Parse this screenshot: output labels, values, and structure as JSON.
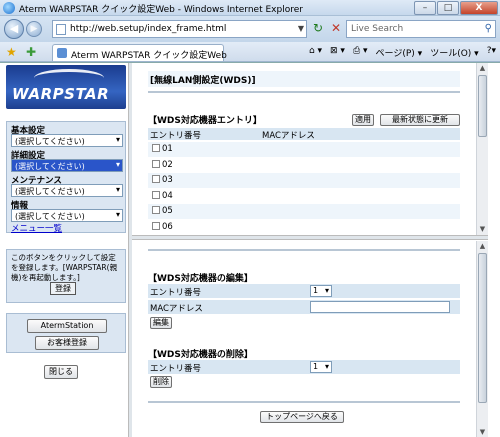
{
  "window": {
    "title": "Aterm WARPSTAR クイック設定Web - Windows Internet Explorer",
    "minimize_label": "–",
    "maximize_label": "□",
    "close_label": "X"
  },
  "address_bar": {
    "url": "http://web.setup/index_frame.html",
    "search_placeholder": "Live Search"
  },
  "tab": {
    "label": "Aterm WARPSTAR クイック設定Web"
  },
  "toolbar": {
    "home": "⌂ ▾",
    "feeds": "⊠ ▾",
    "print": "⎙ ▾",
    "page_menu": "ページ(P) ▾",
    "tools_menu": "ツール(O) ▾",
    "help": "?▾"
  },
  "sidebar": {
    "logo_text": "WARPSTAR",
    "groups": [
      {
        "label": "基本設定",
        "select_value": "(選択してください)"
      },
      {
        "label": "詳細設定",
        "select_value": "(選択してください)"
      },
      {
        "label": "メンテナンス",
        "select_value": "(選択してください)"
      },
      {
        "label": "情報",
        "select_value": "(選択してください)"
      }
    ],
    "menu_list_link": "メニュー一覧",
    "note": "このボタンをクリックして設定を登録します。[WARPSTAR(親機)を再起動します。]",
    "register_button": "登録",
    "aterm_station_button": "AtermStation",
    "customer_register_button": "お客様登録",
    "close_button": "閉じる"
  },
  "main": {
    "page_title": "[無線LAN側設定(WDS)]",
    "entry_section": {
      "title": "【WDS対応機器エントリ】",
      "apply_button": "適用",
      "refresh_button": "最新状態に更新",
      "col_entry": "エントリ番号",
      "col_mac": "MACアドレス",
      "rows": [
        "01",
        "02",
        "03",
        "04",
        "05",
        "06"
      ]
    },
    "edit_section": {
      "title": "【WDS対応機器の編集】",
      "entry_label": "エントリ番号",
      "entry_value": "1",
      "mac_label": "MACアドレス",
      "mac_value": "",
      "edit_button": "編集"
    },
    "delete_section": {
      "title": "【WDS対応機器の削除】",
      "entry_label": "エントリ番号",
      "entry_value": "1",
      "delete_button": "削除"
    },
    "top_page_button": "トップページへ戻る"
  }
}
